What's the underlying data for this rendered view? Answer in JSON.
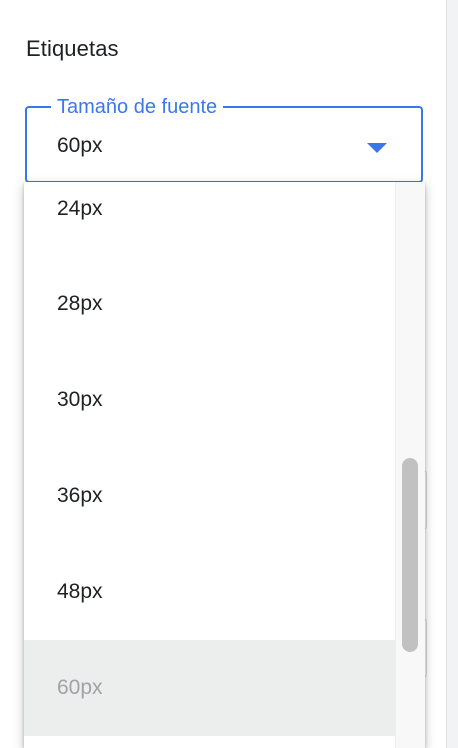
{
  "section": {
    "title": "Etiquetas"
  },
  "font_size_select": {
    "label": "Tamaño de fuente",
    "value": "60px"
  },
  "dropdown": {
    "options": [
      "24px",
      "28px",
      "30px",
      "36px",
      "48px",
      "60px"
    ],
    "selected": "60px"
  },
  "background": {
    "partial_text": "…"
  },
  "colors": {
    "accent": "#3b78e7",
    "selected_bg": "#eceded",
    "text": "#202124"
  }
}
